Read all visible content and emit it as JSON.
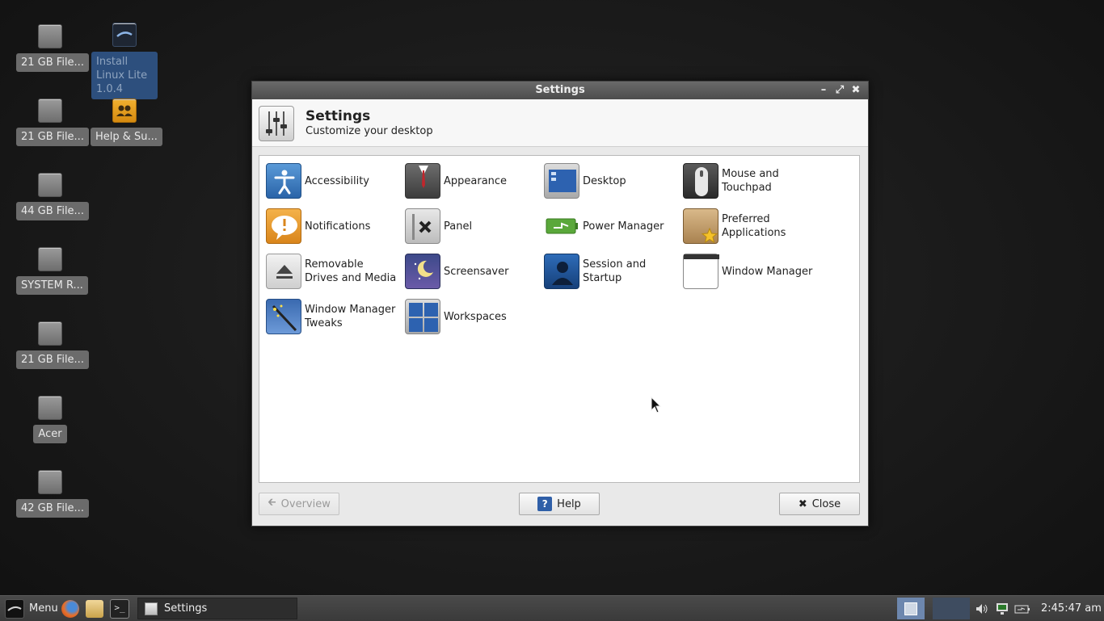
{
  "desktop": {
    "icons": [
      {
        "label": "21 GB File..."
      },
      {
        "label": "21 GB File..."
      },
      {
        "label": "44 GB File..."
      },
      {
        "label": "SYSTEM R..."
      },
      {
        "label": "21 GB File..."
      },
      {
        "label": "Acer"
      },
      {
        "label": "42 GB File..."
      },
      {
        "label": "Install Linux Lite 1.0.4"
      },
      {
        "label": "Help & Su..."
      }
    ]
  },
  "window": {
    "title": "Settings",
    "header_title": "Settings",
    "header_subtitle": "Customize your desktop",
    "items": [
      {
        "label": "Accessibility",
        "icon": "accessibility-icon"
      },
      {
        "label": "Appearance",
        "icon": "appearance-icon"
      },
      {
        "label": "Desktop",
        "icon": "desktop-icon"
      },
      {
        "label": "Mouse and Touchpad",
        "icon": "mouse-icon"
      },
      {
        "label": "Notifications",
        "icon": "notifications-icon"
      },
      {
        "label": "Panel",
        "icon": "panel-icon"
      },
      {
        "label": "Power Manager",
        "icon": "power-manager-icon"
      },
      {
        "label": "Preferred Applications",
        "icon": "preferred-applications-icon"
      },
      {
        "label": "Removable Drives and Media",
        "icon": "removable-drives-icon"
      },
      {
        "label": "Screensaver",
        "icon": "screensaver-icon"
      },
      {
        "label": "Session and Startup",
        "icon": "session-startup-icon"
      },
      {
        "label": "Window Manager",
        "icon": "window-manager-icon"
      },
      {
        "label": "Window Manager Tweaks",
        "icon": "window-manager-tweaks-icon"
      },
      {
        "label": "Workspaces",
        "icon": "workspaces-icon"
      }
    ],
    "buttons": {
      "overview": "Overview",
      "help": "Help",
      "close": "Close"
    }
  },
  "taskbar": {
    "menu_label": "Menu",
    "task_label": "Settings",
    "clock": "2:45:47 am"
  },
  "colors": {
    "accent_blue": "#2f6fb5",
    "taskbar": "#3f3f3f"
  }
}
